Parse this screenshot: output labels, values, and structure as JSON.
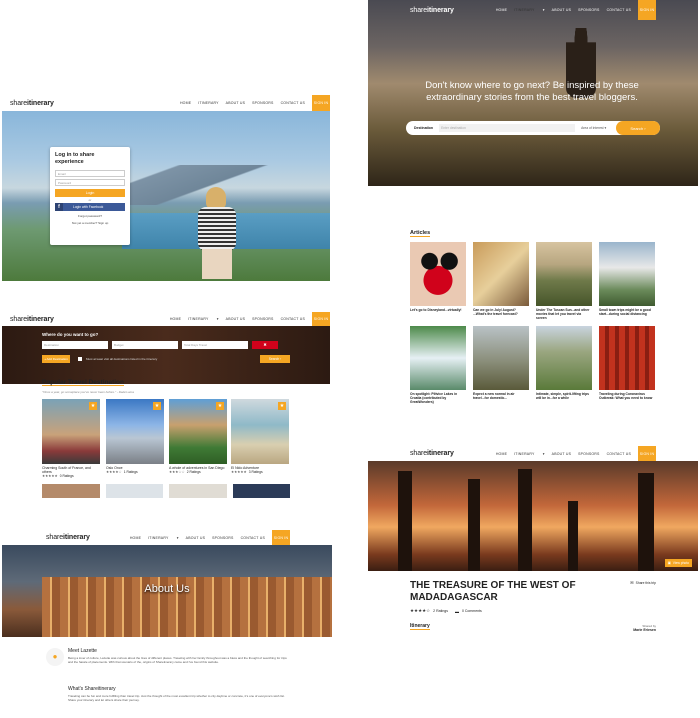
{
  "nav": {
    "logo_light": "share",
    "logo_bold": "itinerary",
    "home": "HOME",
    "itinerary": "ITINERARY",
    "about": "ABOUT US",
    "sponsors": "SPONSORS",
    "contact": "CONTACT US",
    "signin": "SIGN IN"
  },
  "login": {
    "title": "Log in to share experience",
    "email_placeholder": "Email",
    "password_placeholder": "Password",
    "or": "or",
    "login_button": "Login",
    "facebook_button": "Login with Facebook",
    "forgot": "Forgot password?",
    "signup": "Not yet a member? Sign up"
  },
  "search": {
    "title": "Where do you want to go?",
    "destination_placeholder": "Destination",
    "budget_placeholder": "Budget",
    "days_placeholder": "Total Days Travel",
    "add_destination": "+ Add Destination",
    "checkbox_label": "Must at least visit all destinations listed in the itinerary",
    "search_button": "Search ›"
  },
  "popular": {
    "heading": "Popular Travel Destination",
    "quote": "\"Once a year, go someplace you've never been before.\" - Dalai Lama",
    "cards": [
      {
        "title": "Charming South of France, and others",
        "rating": "★★★★★",
        "reviews": "0 Ratings"
      },
      {
        "title": "Oslo Once",
        "rating": "★★★★☆",
        "reviews": "1 Ratings"
      },
      {
        "title": "A whole of adventures in San Diego",
        "rating": "★★★☆☆",
        "reviews": "2 Ratings"
      },
      {
        "title": "El Nido Adventure",
        "rating": "★★★★★",
        "reviews": "3 Ratings"
      }
    ]
  },
  "about": {
    "hero_title": "About Us",
    "meet_heading": "Meet Lazette",
    "meet_body": "Being a lover of culture, Lazette was curious about the lives of different places. Traveling with her family throughout was a bless and the thought of searching for trips and the hassle of placements. With that scenario of the, origins of Sharetinerary came and I've found this website.",
    "what_heading": "What's Shareitinerary",
    "what_body": "Traveling can be fun and more fulfilling than travel trip. Just the thought of the most excellent trip whether to city daytime or concrete, it's one of everyone's wish list. Share your itinerary and let others share their journey."
  },
  "hero": {
    "headline": "Don't know where to go next? Be inspired by these extraordinary stories from the best travel bloggers.",
    "destination_label": "Destination",
    "destination_placeholder": "Enter destination",
    "interest_placeholder": "Area of Interest",
    "search_button": "Search"
  },
  "articles": {
    "heading": "Articles",
    "items": [
      {
        "title": "Let's go to Disneyland...virtually!"
      },
      {
        "title": "Can we go in July/ August? ...What's the travel forecast?"
      },
      {
        "title": "Under The Tuscan Sun...and other movies that let you travel via screen"
      },
      {
        "title": "Small town trips might be a good start...during social distancing"
      },
      {
        "title": "On spotlight: Plitvice Lakes in Croatia (contributed by GreatWonders)"
      },
      {
        "title": "Expect a new normal in air travel...for domestic..."
      },
      {
        "title": "Intimate, simple, spirit-lifting trips will be in...for a while"
      },
      {
        "title": "Traveling during Coronavirus Outbreak: What you need to know"
      }
    ]
  },
  "detail": {
    "view_photo": "View photo",
    "title": "THE TREASURE OF THE WEST OF MADADAGASCAR",
    "rating": "★★★★☆",
    "ratings_text": "2 Ratings",
    "comments_text": "0 Comments",
    "share": "Share this trip",
    "itinerary_tab": "Itinerary",
    "shared_by_label": "Shared by",
    "shared_by_name": "Marie Eriesen"
  },
  "colors": {
    "accent": "#f5a623",
    "facebook": "#3b5998",
    "search_bar": "#3a2418"
  }
}
